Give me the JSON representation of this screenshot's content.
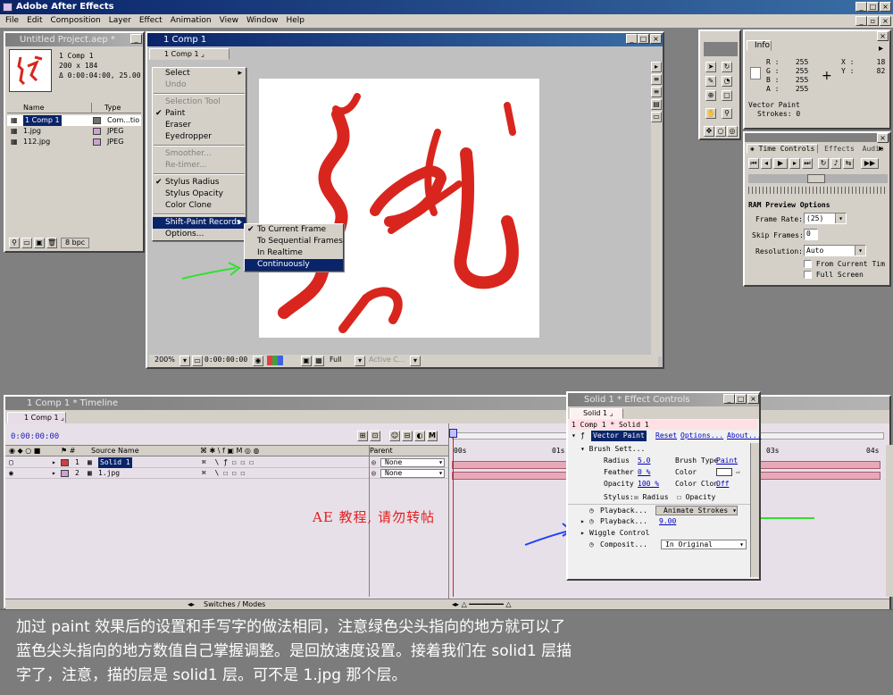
{
  "app": {
    "title": "Adobe After Effects",
    "menu": [
      "File",
      "Edit",
      "Composition",
      "Layer",
      "Effect",
      "Animation",
      "View",
      "Window",
      "Help"
    ]
  },
  "project": {
    "title": "Untitled Project.aep *",
    "comp_name": "1 Comp 1",
    "comp_size": "200 x 184",
    "comp_dur": "Δ 0:00:04:00, 25.00",
    "headers": [
      "Name",
      "Type"
    ],
    "items": [
      {
        "name": "1 Comp 1",
        "type": "Com...tio",
        "color": "#707070"
      },
      {
        "name": "1.jpg",
        "type": "JPEG",
        "color": "#d0a0d0"
      },
      {
        "name": "112.jpg",
        "type": "JPEG",
        "color": "#d0a0d0"
      }
    ],
    "bpc": "8 bpc"
  },
  "comp": {
    "title": "1 Comp 1",
    "tab": "1 Comp 1",
    "zoom": "200%",
    "time": "0:00:00:00",
    "res": "Full",
    "view": "Active C..."
  },
  "context_menu": {
    "items": [
      {
        "label": "Select",
        "sub": true
      },
      {
        "label": "Undo",
        "dis": true
      },
      {
        "sep": true
      },
      {
        "label": "Selection Tool",
        "dis": true
      },
      {
        "label": "Paint",
        "chk": true
      },
      {
        "label": "Eraser"
      },
      {
        "label": "Eyedropper"
      },
      {
        "sep": true
      },
      {
        "label": "Smoother...",
        "dis": true
      },
      {
        "label": "Re-timer...",
        "dis": true
      },
      {
        "sep": true
      },
      {
        "label": "Stylus Radius",
        "chk": true
      },
      {
        "label": "Stylus Opacity"
      },
      {
        "label": "Color Clone"
      },
      {
        "sep": true
      },
      {
        "label": "Shift-Paint Records",
        "sub": true,
        "sel": true
      },
      {
        "label": "Options..."
      }
    ],
    "submenu": [
      {
        "label": "To Current Frame",
        "chk": true
      },
      {
        "label": "To Sequential Frames"
      },
      {
        "label": "In Realtime"
      },
      {
        "label": "Continuously",
        "sel": true
      }
    ]
  },
  "info": {
    "tab": "Info",
    "r": "255",
    "g": "255",
    "b": "255",
    "a": "255",
    "x": "18",
    "y": "82",
    "lines": [
      "Vector Paint",
      "Strokes: 0"
    ]
  },
  "time_controls": {
    "tab1": "Time Controls",
    "tab2": "Effects",
    "tab3": "Audio",
    "heading": "RAM Preview Options",
    "frame_rate_label": "Frame Rate:",
    "frame_rate": "(25)",
    "skip_label": "Skip Frames:",
    "skip": "0",
    "res_label": "Resolution:",
    "res": "Auto",
    "cb1": "From Current Tim",
    "cb2": "Full Screen"
  },
  "timeline": {
    "title": "1 Comp 1 * Timeline",
    "tab": "1 Comp 1",
    "time": "0:00:00:00",
    "headers": [
      "Source Name",
      "Parent"
    ],
    "layers": [
      {
        "num": "1",
        "name": "Solid 1",
        "parent": "None",
        "color": "#d04040"
      },
      {
        "num": "2",
        "name": "1.jpg",
        "parent": "None",
        "color": "#d0a0d0"
      }
    ],
    "ruler": [
      "00s",
      "01s",
      "03s",
      "04s"
    ],
    "footer": "Switches / Modes",
    "watermark": "AE 教程, 请勿转帖"
  },
  "effect_controls": {
    "title": "Solid 1 * Effect Controls",
    "tab": "Solid 1",
    "path": "1 Comp 1 * Solid 1",
    "effect": "Vector Paint",
    "reset": "Reset",
    "options": "Options...",
    "about": "About...",
    "brush": "Brush Sett...",
    "radius_l": "Radius",
    "radius": "5.0",
    "feather_l": "Feather",
    "feather": "0 %",
    "opacity_l": "Opacity",
    "opacity": "100 %",
    "btype_l": "Brush Type",
    "btype": "Paint",
    "color_l": "Color",
    "cclone_l": "Color Clon",
    "cclone": "Off",
    "stylus": "Stylus:",
    "s_radius": "Radius",
    "s_opacity": "Opacity",
    "pb1": "Playback...",
    "pb1v": "Animate Strokes",
    "pb2": "Playback...",
    "pb2v": "9.00",
    "wiggle": "Wiggle Control",
    "comp": "Composit...",
    "compv": "In Original"
  },
  "caption": {
    "lines": [
      "加过 paint 效果后的设置和手写字的做法相同，注意绿色尖头指向的地方就可以了",
      "蓝色尖头指向的地方数值自己掌握调整。是回放速度设置。接着我们在 solid1 层描",
      "字了，注意，描的层是 solid1 层。可不是 1.jpg 那个层。"
    ]
  },
  "colors": {
    "title_active": "#0a246a",
    "paint_red": "#d8261e",
    "panel": "#d4d0c8"
  }
}
